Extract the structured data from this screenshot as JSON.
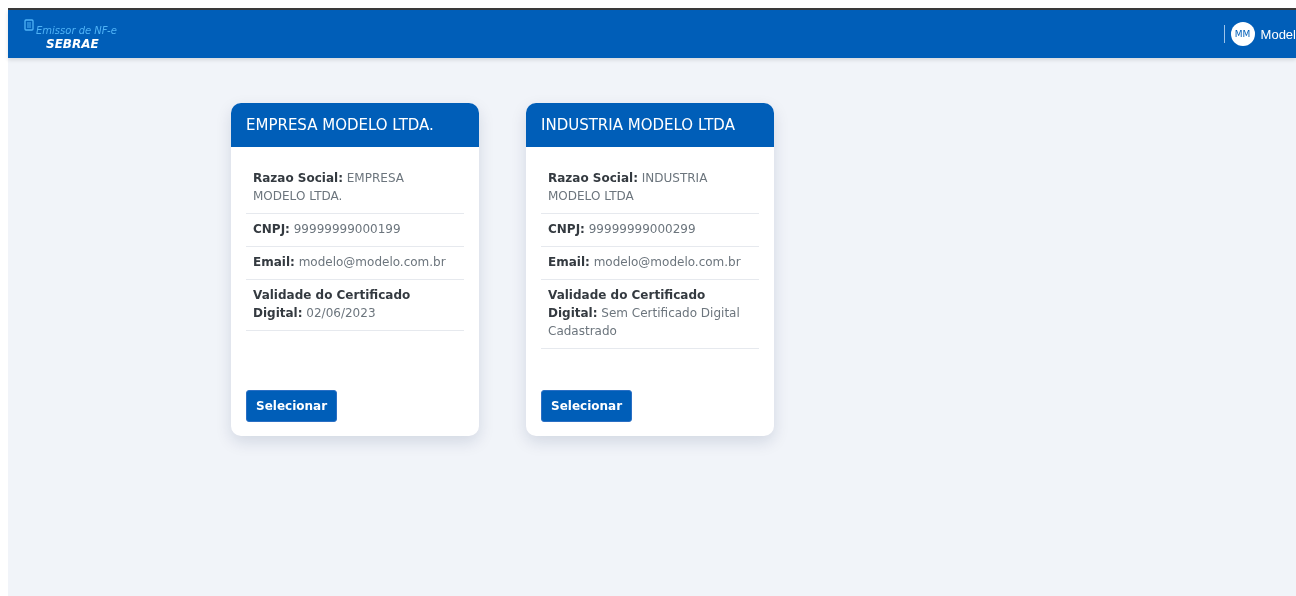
{
  "header": {
    "logo_title": "Emissor de NF-e",
    "logo_subtitle": "SEBRAE",
    "user": {
      "initials": "MM",
      "name": "Model"
    }
  },
  "companies": [
    {
      "title": "EMPRESA MODELO LTDA.",
      "fields": [
        {
          "label": "Razao Social:",
          "value": "EMPRESA MODELO LTDA."
        },
        {
          "label": "CNPJ:",
          "value": "99999999000199"
        },
        {
          "label": "Email:",
          "value": "modelo@modelo.com.br"
        },
        {
          "label": "Validade do Certificado Digital:",
          "value": "02/06/2023"
        }
      ],
      "button": "Selecionar"
    },
    {
      "title": "INDUSTRIA MODELO LTDA",
      "fields": [
        {
          "label": "Razao Social:",
          "value": "INDUSTRIA MODELO LTDA"
        },
        {
          "label": "CNPJ:",
          "value": "99999999000299"
        },
        {
          "label": "Email:",
          "value": "modelo@modelo.com.br"
        },
        {
          "label": "Validade do Certificado Digital:",
          "value": "Sem Certificado Digital Cadastrado"
        }
      ],
      "button": "Selecionar"
    }
  ]
}
